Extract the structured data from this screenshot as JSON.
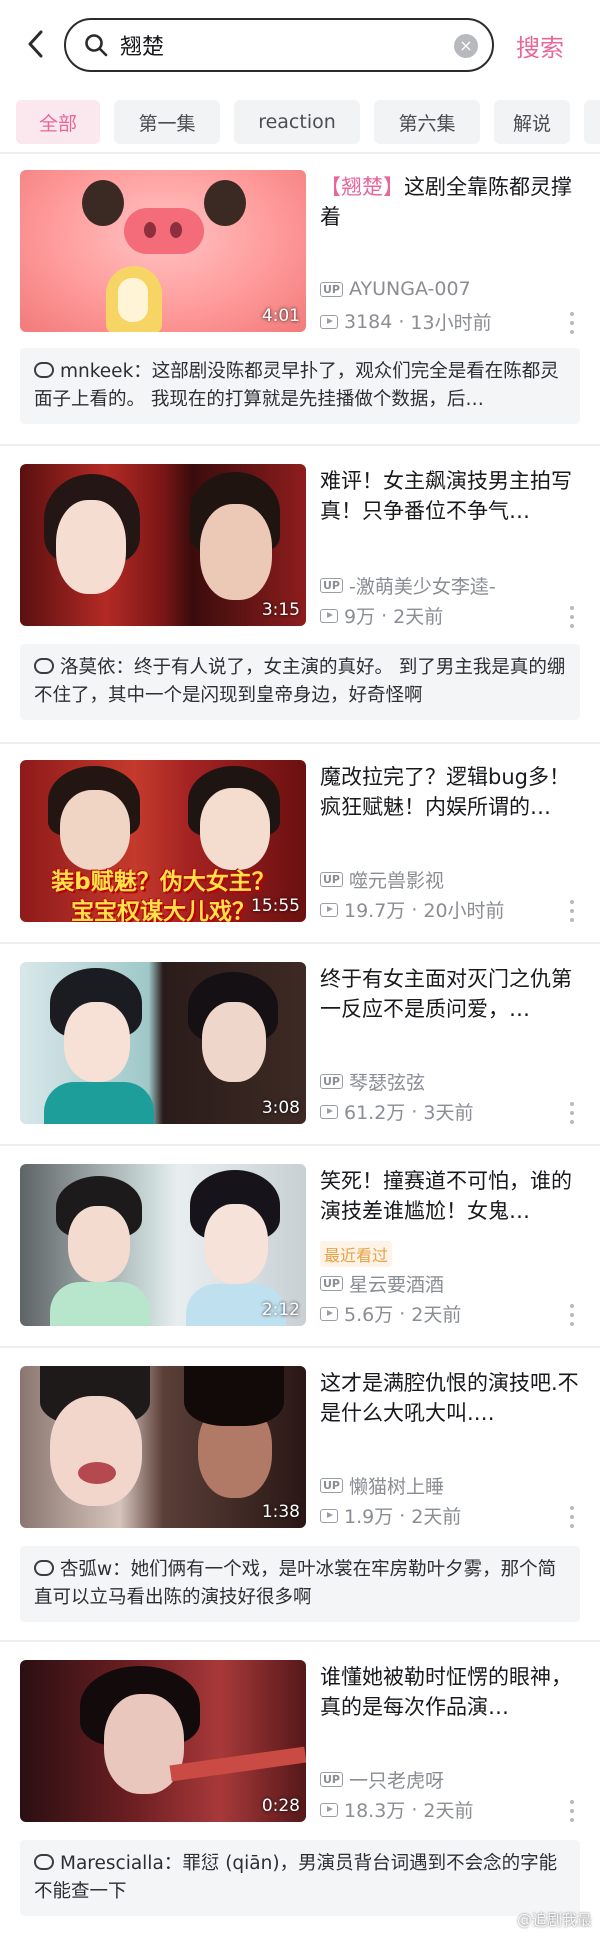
{
  "search": {
    "query": "翘楚",
    "button_label": "搜索"
  },
  "tabs": [
    {
      "label": "全部"
    },
    {
      "label": "第一集"
    },
    {
      "label": "reaction"
    },
    {
      "label": "第六集"
    },
    {
      "label": "解说"
    }
  ],
  "videos": [
    {
      "title_keyword": "【翘楚】",
      "title": "这剧全靠陈都灵撑着",
      "duration": "4:01",
      "uploader": "AYUNGA-007",
      "views": "3184",
      "time": "13小时前",
      "comment_user": "mnkeek",
      "comment_text": "这部剧没陈都灵早扑了，观众们完全是看在陈都灵面子上看的。 我现在的打算就是先挂播做个数据，后…"
    },
    {
      "title": "难评！女主飙演技男主拍写真！只争番位不争气…",
      "duration": "3:15",
      "uploader": "-激萌美少女李逵-",
      "views": "9万",
      "time": "2天前",
      "comment_user": "洛莫依",
      "comment_text": "终于有人说了，女主演的真好。 到了男主我是真的绷不住了，其中一个是闪现到皇帝身边，好奇怪啊"
    },
    {
      "title": "魔改拉完了？逻辑bug多！疯狂赋魅！内娱所谓的…",
      "duration": "15:55",
      "uploader": "噬元兽影视",
      "views": "19.7万",
      "time": "20小时前",
      "caption_line1": "装b赋魅？伪大女主？",
      "caption_line2": "宝宝权谋大儿戏？"
    },
    {
      "title": "终于有女主面对灭门之仇第一反应不是质问爱，…",
      "duration": "3:08",
      "uploader": "琴瑟弦弦",
      "views": "61.2万",
      "time": "3天前"
    },
    {
      "title": "笑死！撞赛道不可怕，谁的演技差谁尴尬！女鬼…",
      "duration": "2:12",
      "badge": "最近看过",
      "uploader": "星云要酒酒",
      "views": "5.6万",
      "time": "2天前"
    },
    {
      "title": "这才是满腔仇恨的演技吧.不是什么大吼大叫.…",
      "duration": "1:38",
      "uploader": "懒猫树上睡",
      "views": "1.9万",
      "time": "2天前",
      "comment_user": "杏弧w",
      "comment_text": "她们俩有一个戏，是叶冰裳在牢房勒叶夕雾，那个简直可以立马看出陈的演技好很多啊"
    },
    {
      "title": "谁懂她被勒时怔愣的眼神，真的是每次作品演…",
      "duration": "0:28",
      "uploader": "一只老虎呀",
      "views": "18.3万",
      "time": "2天前",
      "comment_user": "Marescialla",
      "comment_text": "罪愆 (qiān)，男演员背台词遇到不会念的字能不能查一下"
    }
  ],
  "colors": {
    "accent": "#e8679a",
    "text": "#18191c",
    "muted": "#8a8d93",
    "comment_bg": "#f4f5f7"
  },
  "watermark": "@追剧我最"
}
